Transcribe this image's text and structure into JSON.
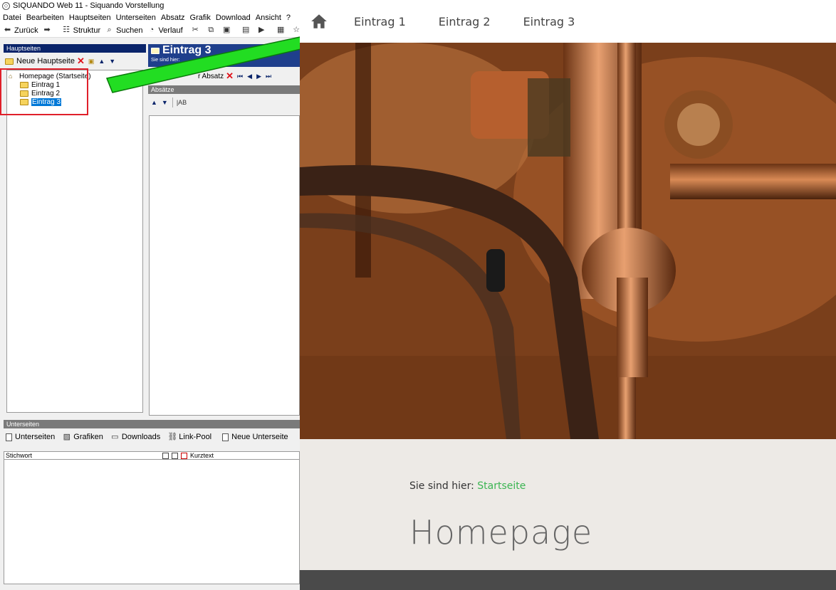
{
  "app": {
    "title": "SIQUANDO Web 11 - Siquando Vorstellung",
    "menu": [
      "Datei",
      "Bearbeiten",
      "Hauptseiten",
      "Unterseiten",
      "Absatz",
      "Grafik",
      "Download",
      "Ansicht",
      "?"
    ],
    "toolbar": {
      "back_label": "Zurück",
      "struktur_label": "Struktur",
      "suchen_label": "Suchen",
      "verlauf_label": "Verlauf"
    },
    "hauptseiten": {
      "header": "Hauptseiten",
      "new_label": "Neue Hauptseite",
      "tree": [
        {
          "label": "Homepage (Startseite)",
          "level": 0
        },
        {
          "label": "Eintrag 1",
          "level": 1
        },
        {
          "label": "Eintrag 2",
          "level": 1
        },
        {
          "label": "Eintrag 3",
          "level": 1,
          "selected": true
        }
      ]
    },
    "entry": {
      "title": "Eintrag 3",
      "subtitle": "Sie sind hier:",
      "absatz_label": "r Absatz",
      "absaetze_header": "Absätze"
    },
    "unterseiten": {
      "header": "Unterseiten",
      "tabs": [
        "Unterseiten",
        "Grafiken",
        "Downloads",
        "Link-Pool",
        "Neue Unterseite"
      ],
      "col_stichwort": "Stichwort",
      "col_kurztext": "Kurztext"
    }
  },
  "site": {
    "nav": [
      "Eintrag 1",
      "Eintrag 2",
      "Eintrag 3"
    ],
    "breadcrumb_prefix": "Sie sind hier:",
    "breadcrumb_link": "Startseite",
    "page_title": "Homepage",
    "colors": {
      "link": "#3bb552",
      "footer": "#4a4a4a",
      "content_bg": "#edeae6"
    }
  }
}
